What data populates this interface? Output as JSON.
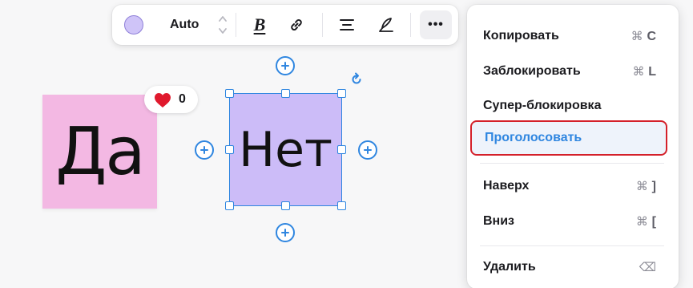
{
  "colors": {
    "canvas": "#f7f7f8",
    "sticker_yes": "#f3b8e3",
    "sticker_no": "#ccbcf8",
    "selection": "#2f86e0",
    "highlight_border": "#d4202a",
    "heart": "#e0192d",
    "color_swatch": "#cfc4f8"
  },
  "toolbar": {
    "color_swatch_icon": "color-circle",
    "font_size_value": "Auto",
    "stepper_icon": "up-down-chevrons",
    "bold_label": "B",
    "link_icon": "link-icon",
    "align_icon": "align-center-icon",
    "pen_icon": "pen-icon",
    "more_label": "•••"
  },
  "canvas": {
    "sticker_yes_text": "Да",
    "sticker_no_text": "Нет",
    "vote_badge": {
      "icon": "heart",
      "count": "0"
    }
  },
  "menu": {
    "items": [
      {
        "label": "Копировать",
        "shortcut_symbol": "⌘",
        "shortcut_key": "C"
      },
      {
        "label": "Заблокировать",
        "shortcut_symbol": "⌘",
        "shortcut_key": "L"
      },
      {
        "label": "Супер-блокировка",
        "shortcut_symbol": "",
        "shortcut_key": ""
      },
      {
        "label": "Проголосовать",
        "shortcut_symbol": "",
        "shortcut_key": ""
      },
      {
        "label": "Наверх",
        "shortcut_symbol": "⌘",
        "shortcut_key": "]"
      },
      {
        "label": "Вниз",
        "shortcut_symbol": "⌘",
        "shortcut_key": "["
      },
      {
        "label": "Удалить",
        "shortcut_symbol": "⌫",
        "shortcut_key": ""
      }
    ]
  }
}
